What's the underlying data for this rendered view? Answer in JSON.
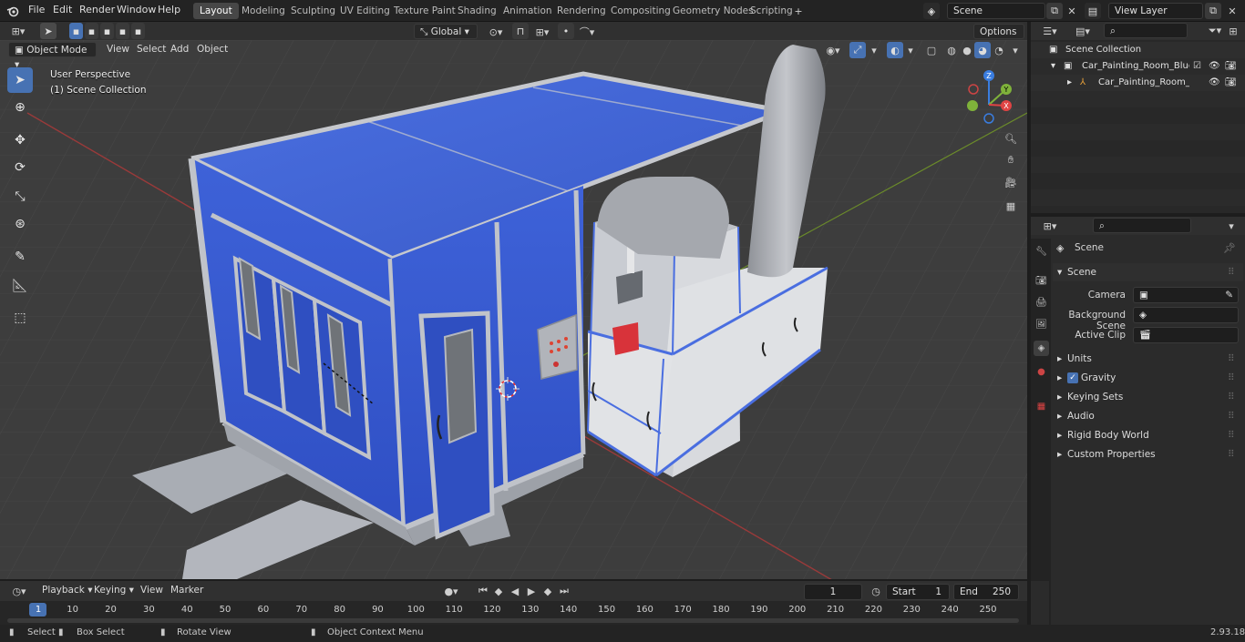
{
  "menu": {
    "file": "File",
    "edit": "Edit",
    "render": "Render",
    "window": "Window",
    "help": "Help"
  },
  "workspaces": [
    "Layout",
    "Modeling",
    "Sculpting",
    "UV Editing",
    "Texture Paint",
    "Shading",
    "Animation",
    "Rendering",
    "Compositing",
    "Geometry Nodes",
    "Scripting"
  ],
  "scene_field": "Scene",
  "view_layer_field": "View Layer",
  "viewport_header": {
    "mode": "Object Mode",
    "view": "View",
    "select": "Select",
    "add": "Add",
    "object": "Object",
    "orientation": "Global",
    "options": "Options"
  },
  "viewport_overlay": {
    "perspective": "User Perspective",
    "collection": "(1) Scene Collection"
  },
  "gizmo_axes": {
    "x": "X",
    "y": "Y",
    "z": "Z"
  },
  "outliner": {
    "root": "Scene Collection",
    "items": [
      {
        "label": "Car_Painting_Room_Blue_Col"
      },
      {
        "label": "Car_Painting_Room_Blue"
      }
    ]
  },
  "properties": {
    "header": "Scene",
    "section": "Scene",
    "fields": [
      {
        "label": "Camera"
      },
      {
        "label": "Background Scene"
      },
      {
        "label": "Active Clip"
      }
    ],
    "panels": [
      "Units",
      "Gravity",
      "Keying Sets",
      "Audio",
      "Rigid Body World",
      "Custom Properties"
    ]
  },
  "timeline": {
    "playback": "Playback",
    "keying": "Keying",
    "view": "View",
    "marker": "Marker",
    "current_frame": "1",
    "start_label": "Start",
    "start": "1",
    "end_label": "End",
    "end": "250",
    "ticks": [
      "1",
      "10",
      "20",
      "30",
      "40",
      "50",
      "60",
      "70",
      "80",
      "90",
      "100",
      "110",
      "120",
      "130",
      "140",
      "150",
      "160",
      "170",
      "180",
      "190",
      "200",
      "210",
      "220",
      "230",
      "240",
      "250"
    ]
  },
  "status": {
    "select": "Select",
    "box_select": "Box Select",
    "rotate_view": "Rotate View",
    "context_menu": "Object Context Menu",
    "version": "2.93.18"
  },
  "colors": {
    "accent": "#4772b3",
    "booth_blue": "#3f62d6",
    "frame_gray": "#b9bcc2",
    "viewport_bg": "#3d3d3d"
  }
}
